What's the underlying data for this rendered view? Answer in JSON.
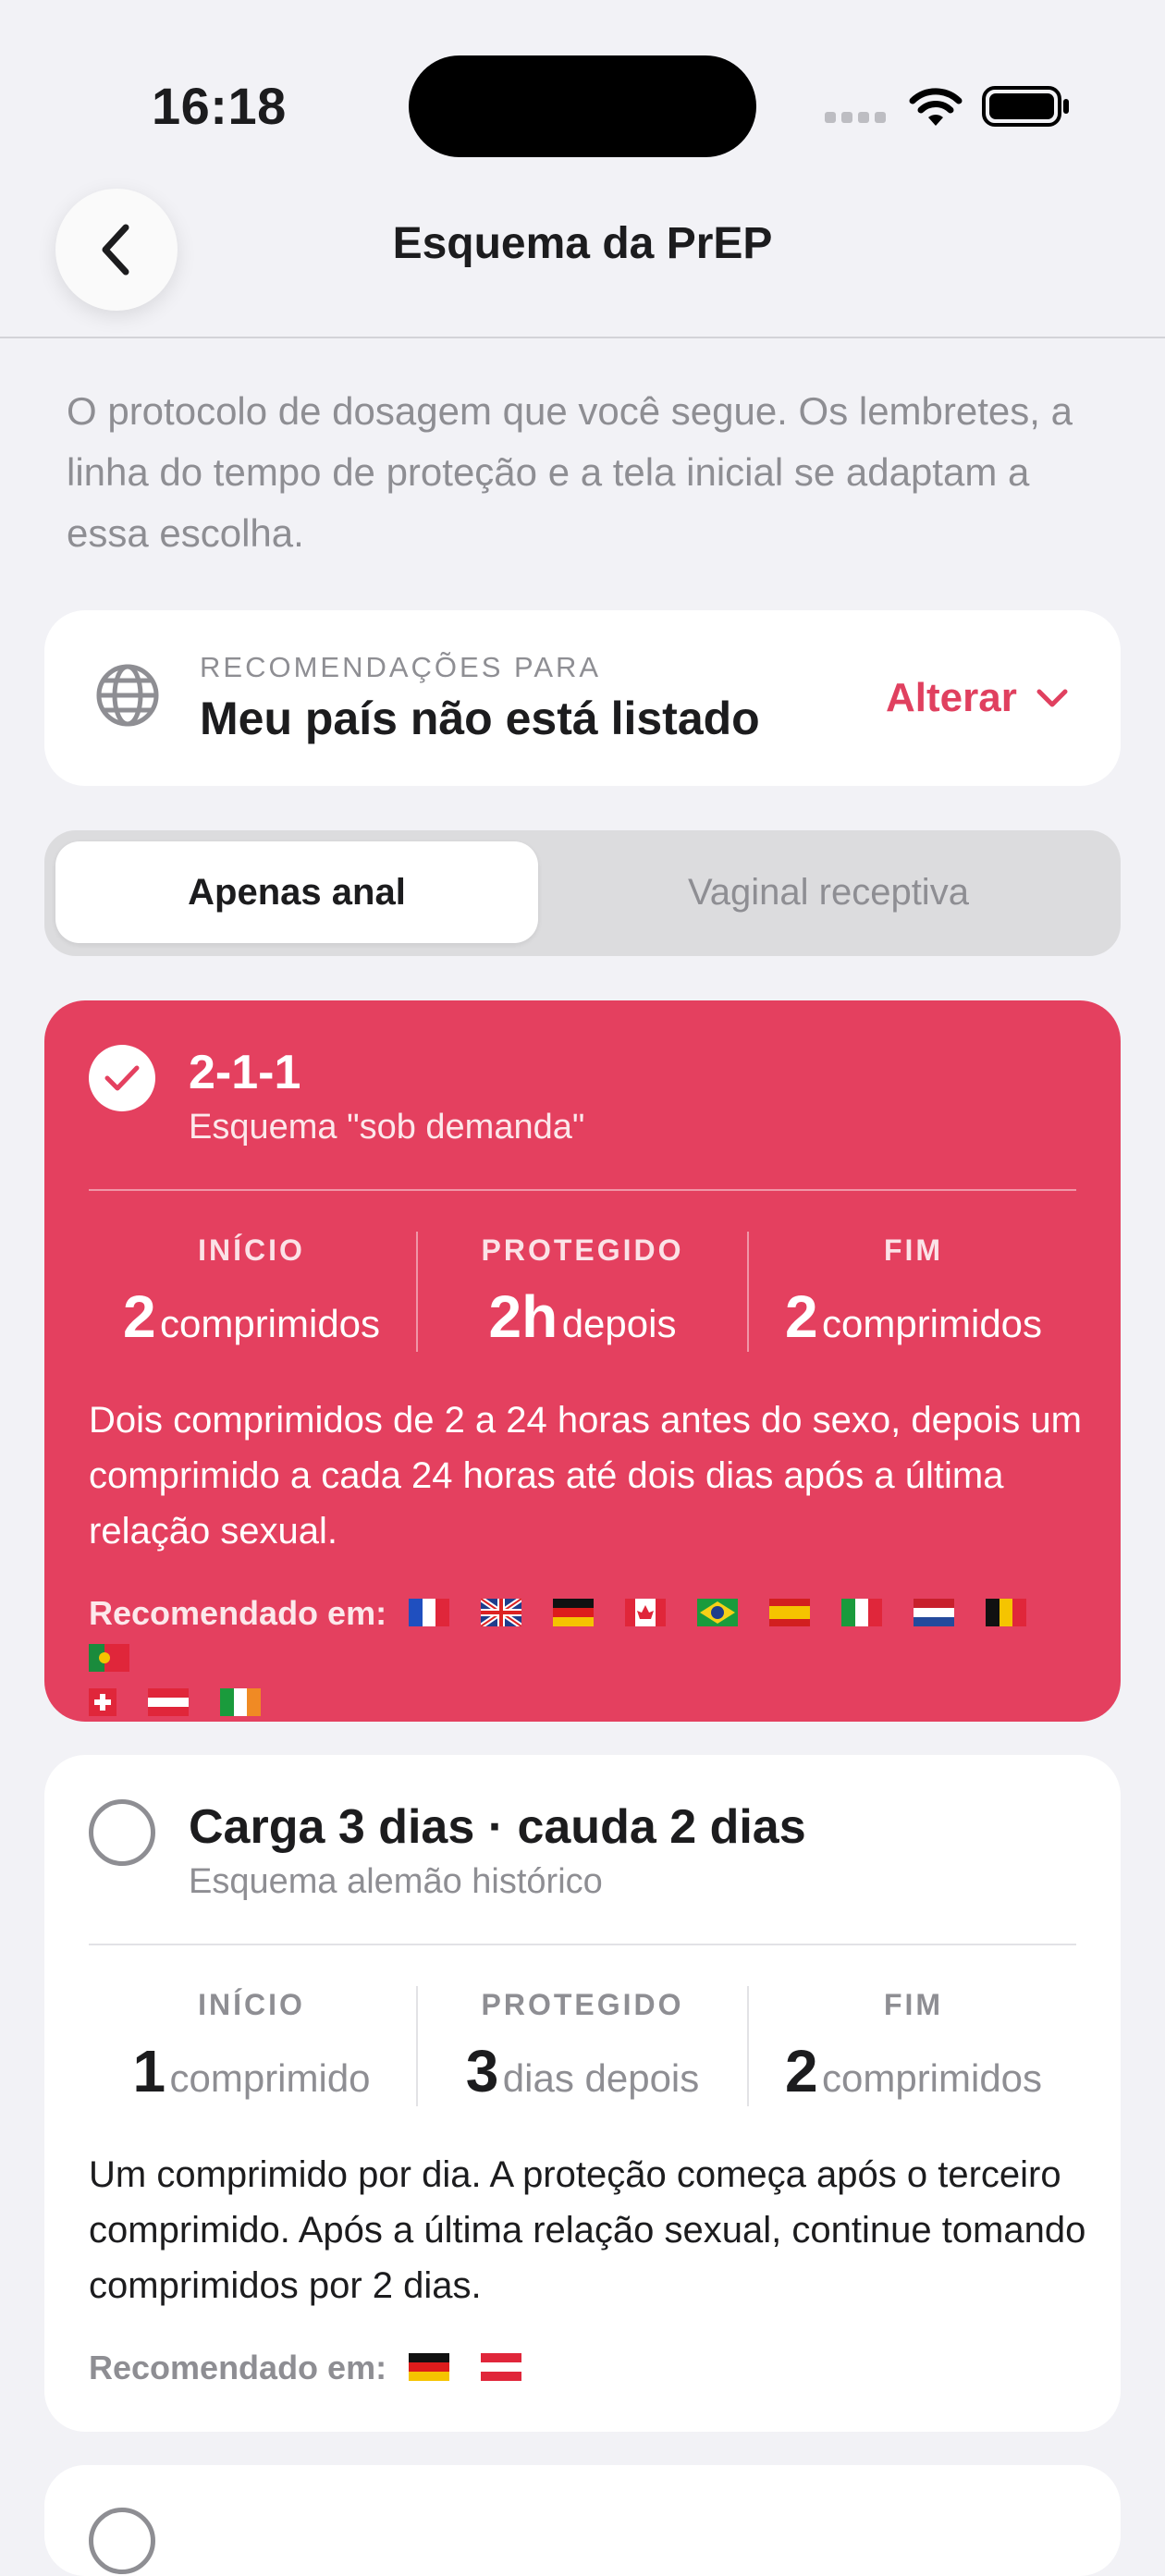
{
  "status": {
    "time": "16:18"
  },
  "nav": {
    "title": "Esquema da PrEP"
  },
  "intro": "O protocolo de dosagem que você segue. Os lembretes, a linha do tempo de proteção e a tela inicial se adaptam a essa escolha.",
  "country": {
    "label": "RECOMENDAÇÕES PARA",
    "name": "Meu país não está listado",
    "change_label": "Alterar"
  },
  "segments": {
    "active": "Apenas anal",
    "inactive": "Vaginal receptiva"
  },
  "regimens": [
    {
      "title": "2-1-1",
      "subtitle": "Esquema \"sob demanda\"",
      "selected": true,
      "cols": [
        {
          "label": "INÍCIO",
          "num": "2",
          "unit": "comprimidos"
        },
        {
          "label": "PROTEGIDO",
          "num": "2h",
          "unit": "depois"
        },
        {
          "label": "FIM",
          "num": "2",
          "unit": "comprimidos"
        }
      ],
      "description": "Dois comprimidos de 2 a 24 horas antes do sexo, depois um comprimido a cada 24 horas até dois dias após a última relação sexual.",
      "recommended_label": "Recomendado em:",
      "flags": [
        "flag-fr",
        "flag-gb",
        "flag-de",
        "flag-ca",
        "flag-br",
        "flag-es",
        "flag-it",
        "flag-nl",
        "flag-be",
        "flag-pt",
        "flag-ch",
        "flag-at",
        "flag-ie"
      ]
    },
    {
      "title": "Carga 3 dias · cauda 2 dias",
      "subtitle": "Esquema alemão histórico",
      "selected": false,
      "cols": [
        {
          "label": "INÍCIO",
          "num": "1",
          "unit": "comprimido"
        },
        {
          "label": "PROTEGIDO",
          "num": "3",
          "unit": "dias depois"
        },
        {
          "label": "FIM",
          "num": "2",
          "unit": "comprimidos"
        }
      ],
      "description": "Um comprimido por dia. A proteção começa após o terceiro comprimido. Após a última relação sexual, continue tomando comprimidos por 2 dias.",
      "recommended_label": "Recomendado em:",
      "flags": [
        "flag-de",
        "flag-at"
      ]
    }
  ],
  "colors": {
    "accent": "#e4405f",
    "background": "#f2f2f6"
  }
}
